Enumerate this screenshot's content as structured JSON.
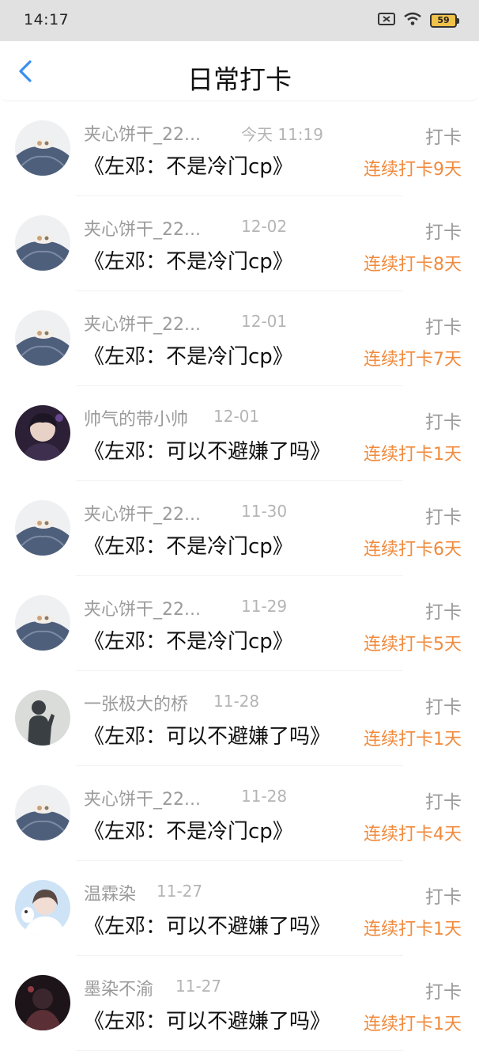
{
  "status": {
    "time": "14:17",
    "battery": "59"
  },
  "header": {
    "title": "日常打卡"
  },
  "colors": {
    "accent": "#3b8df1",
    "streak": "#f08a3c",
    "meta": "#9b9b9b"
  },
  "items": [
    {
      "name": "夹心饼干_22...",
      "date": "今天 11:19",
      "book": "《左邓：不是冷门cp》",
      "tag": "打卡",
      "streak": "连续打卡9天",
      "avatar": "mountain"
    },
    {
      "name": "夹心饼干_22...",
      "date": "12-02",
      "book": "《左邓：不是冷门cp》",
      "tag": "打卡",
      "streak": "连续打卡8天",
      "avatar": "mountain"
    },
    {
      "name": "夹心饼干_22...",
      "date": "12-01",
      "book": "《左邓：不是冷门cp》",
      "tag": "打卡",
      "streak": "连续打卡7天",
      "avatar": "mountain"
    },
    {
      "name": "帅气的带小帅",
      "date": "12-01",
      "book": "《左邓：可以不避嫌了吗》",
      "tag": "打卡",
      "streak": "连续打卡1天",
      "avatar": "boy"
    },
    {
      "name": "夹心饼干_22...",
      "date": "11-30",
      "book": "《左邓：不是冷门cp》",
      "tag": "打卡",
      "streak": "连续打卡6天",
      "avatar": "mountain"
    },
    {
      "name": "夹心饼干_22...",
      "date": "11-29",
      "book": "《左邓：不是冷门cp》",
      "tag": "打卡",
      "streak": "连续打卡5天",
      "avatar": "mountain"
    },
    {
      "name": "一张极大的桥",
      "date": "11-28",
      "book": "《左邓：可以不避嫌了吗》",
      "tag": "打卡",
      "streak": "连续打卡1天",
      "avatar": "silhouette"
    },
    {
      "name": "夹心饼干_22...",
      "date": "11-28",
      "book": "《左邓：不是冷门cp》",
      "tag": "打卡",
      "streak": "连续打卡4天",
      "avatar": "mountain"
    },
    {
      "name": "温霖染",
      "date": "11-27",
      "book": "《左邓：可以不避嫌了吗》",
      "tag": "打卡",
      "streak": "连续打卡1天",
      "avatar": "girl"
    },
    {
      "name": "墨染不渝",
      "date": "11-27",
      "book": "《左邓：可以不避嫌了吗》",
      "tag": "打卡",
      "streak": "连续打卡1天",
      "avatar": "dark"
    }
  ]
}
